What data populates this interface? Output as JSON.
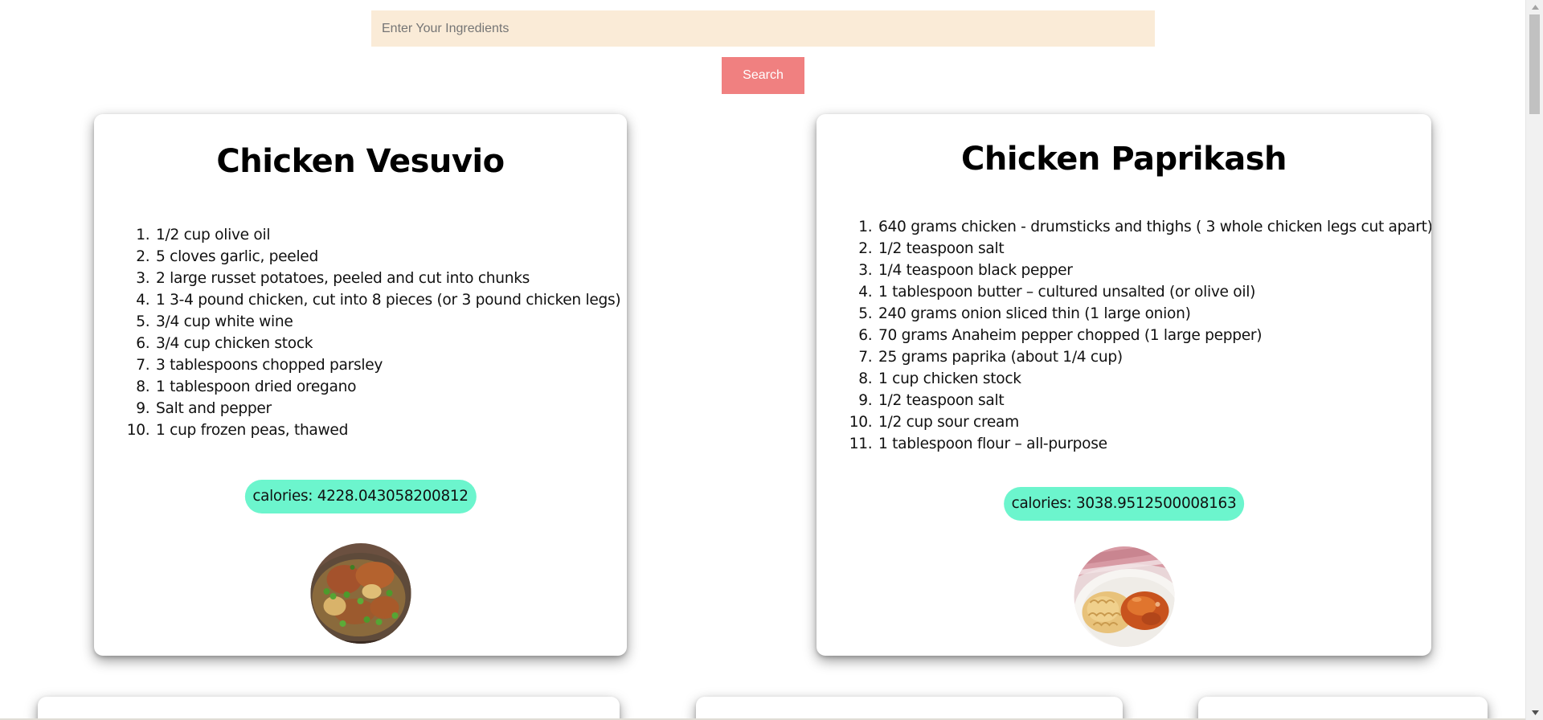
{
  "search": {
    "placeholder": "Enter Your Ingredients",
    "value": "",
    "button_label": "Search"
  },
  "recipes": [
    {
      "title": "Chicken Vesuvio",
      "ingredients": [
        "1/2 cup olive oil",
        "5 cloves garlic, peeled",
        "2 large russet potatoes, peeled and cut into chunks",
        "1 3-4 pound chicken, cut into 8 pieces (or 3 pound chicken legs)",
        "3/4 cup white wine",
        "3/4 cup chicken stock",
        "3 tablespoons chopped parsley",
        "1 tablespoon dried oregano",
        "Salt and pepper",
        "1 cup frozen peas, thawed"
      ],
      "calories": "calories: 4228.043058200812",
      "image_icon": "food-photo-chicken-vesuvio"
    },
    {
      "title": "Chicken Paprikash",
      "ingredients": [
        "640 grams chicken - drumsticks and thighs ( 3 whole chicken legs cut apart)",
        "1/2 teaspoon salt",
        "1/4 teaspoon black pepper",
        "1 tablespoon butter – cultured unsalted (or olive oil)",
        "240 grams onion sliced thin (1 large onion)",
        "70 grams Anaheim pepper chopped (1 large pepper)",
        "25 grams paprika (about 1/4 cup)",
        "1 cup chicken stock",
        "1/2 teaspoon salt",
        "1/2 cup sour cream",
        "1 tablespoon flour – all-purpose"
      ],
      "calories": "calories: 3038.9512500008163",
      "image_icon": "food-photo-chicken-paprikash"
    }
  ],
  "colors": {
    "search_background": "#faebd7",
    "button_background": "#f08080",
    "calories_badge": "#6cf5cd"
  }
}
